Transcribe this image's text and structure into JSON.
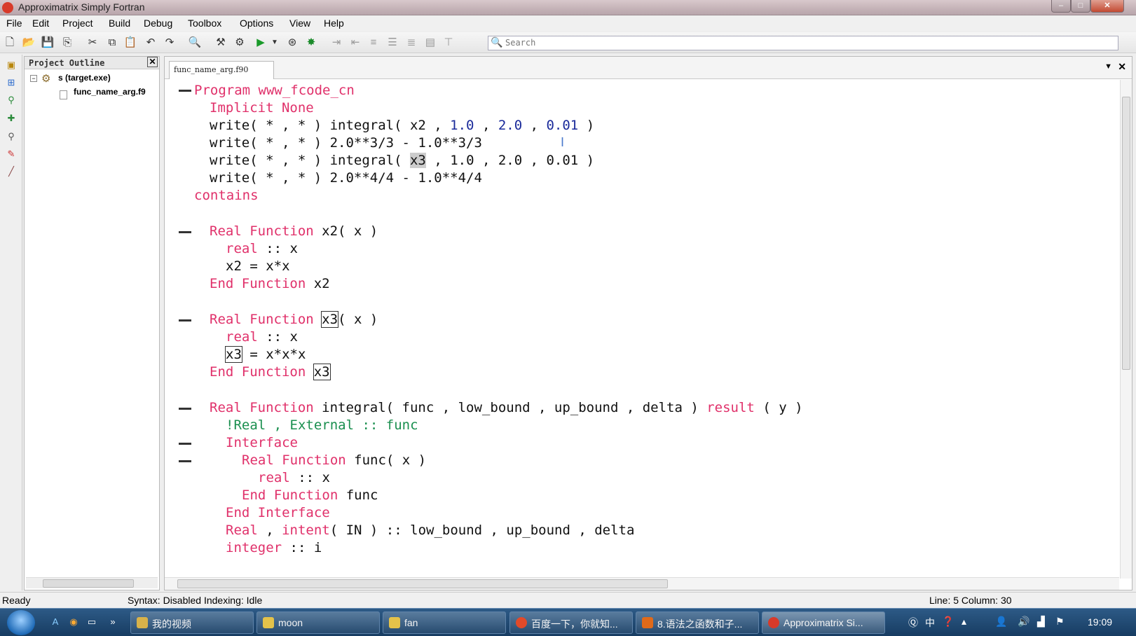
{
  "window": {
    "title": "Approximatrix Simply Fortran"
  },
  "menu": [
    "File",
    "Edit",
    "Project",
    "Build",
    "Debug",
    "Toolbox",
    "Options",
    "View",
    "Help"
  ],
  "search": {
    "placeholder": "Search"
  },
  "toolbar_icons": [
    "new-file-icon",
    "open-folder-icon",
    "save-icon",
    "save-as-icon",
    "cut-icon",
    "copy-icon",
    "paste-icon",
    "undo-icon",
    "redo-icon",
    "find-icon",
    "build-icon",
    "settings-gear-icon",
    "run-icon",
    "run-dropdown-icon",
    "debug-icon",
    "bug-icon",
    "indent-icon",
    "outdent-icon",
    "align-icon",
    "comment-icon",
    "uncomment-icon",
    "block-icon",
    "bookmark-icon"
  ],
  "outline": {
    "title": "Project Outline",
    "target": "s (target.exe)",
    "file": "func_name_arg.f9"
  },
  "editor": {
    "tab": "func_name_arg.f90",
    "lines": {
      "l1": "Program www_fcode_cn",
      "l2": "Implicit None",
      "l3_a": "write( * , * ) integral( x2 , ",
      "l3_b": "1.0",
      "l3_c": " , ",
      "l3_d": "2.0",
      "l3_e": " , ",
      "l3_f": "0.01",
      "l3_g": " )",
      "l4": "write( * , * ) 2.0**3/3 - 1.0**3/3",
      "l5_a": "write( * , * ) integral( ",
      "l5_sel": "x3",
      "l5_b": " , 1.0 , 2.0 , 0.01 )",
      "l6": "write( * , * ) 2.0**4/4 - 1.0**4/4",
      "l7": "contains",
      "l9_kw": "Real Function",
      "l9_rest": " x2( x )",
      "l10_kw": "real",
      "l10_rest": " :: x",
      "l11": "x2 = x*x",
      "l12_kw": "End Function",
      "l12_rest": " x2",
      "l14_kw": "Real Function",
      "l14_box": "x3",
      "l14_rest": "( x )",
      "l15_kw": "real",
      "l15_rest": " :: x",
      "l16_box": "x3",
      "l16_rest": " = x*x*x",
      "l17_kw": "End Function",
      "l17_box": "x3",
      "l19_kw": "Real Function",
      "l19_mid": " integral( func , low_bound , up_bound , delta ) ",
      "l19_kw2": "result",
      "l19_rest": " ( y )",
      "l20": "!Real , External :: func",
      "l21": "Interface",
      "l22_kw": "Real Function",
      "l22_rest": " func( x )",
      "l23_kw": "real",
      "l23_rest": " :: x",
      "l24_kw": "End Function",
      "l24_rest": " func",
      "l25": "End Interface",
      "l26_kw": "Real",
      "l26_b": " , ",
      "l26_kw2": "intent",
      "l26_c": "( IN ) :: low_bound , up_bound , delta",
      "l27_kw": "integer",
      "l27_rest": " :: i"
    }
  },
  "status": {
    "ready": "Ready",
    "syntax": "Syntax: Disabled  Indexing: Idle",
    "position": "Line: 5 Column: 30"
  },
  "taskbar": {
    "tasks": [
      "我的视频",
      "moon",
      "fan",
      "百度一下，你就知...",
      "8.语法之函数和子...",
      "Approximatrix Si..."
    ],
    "ime": "中",
    "clock": "19:09"
  },
  "colors": {
    "keyword": "#e0306a",
    "number": "#1a2a9a",
    "comment": "#1a8f4f"
  }
}
